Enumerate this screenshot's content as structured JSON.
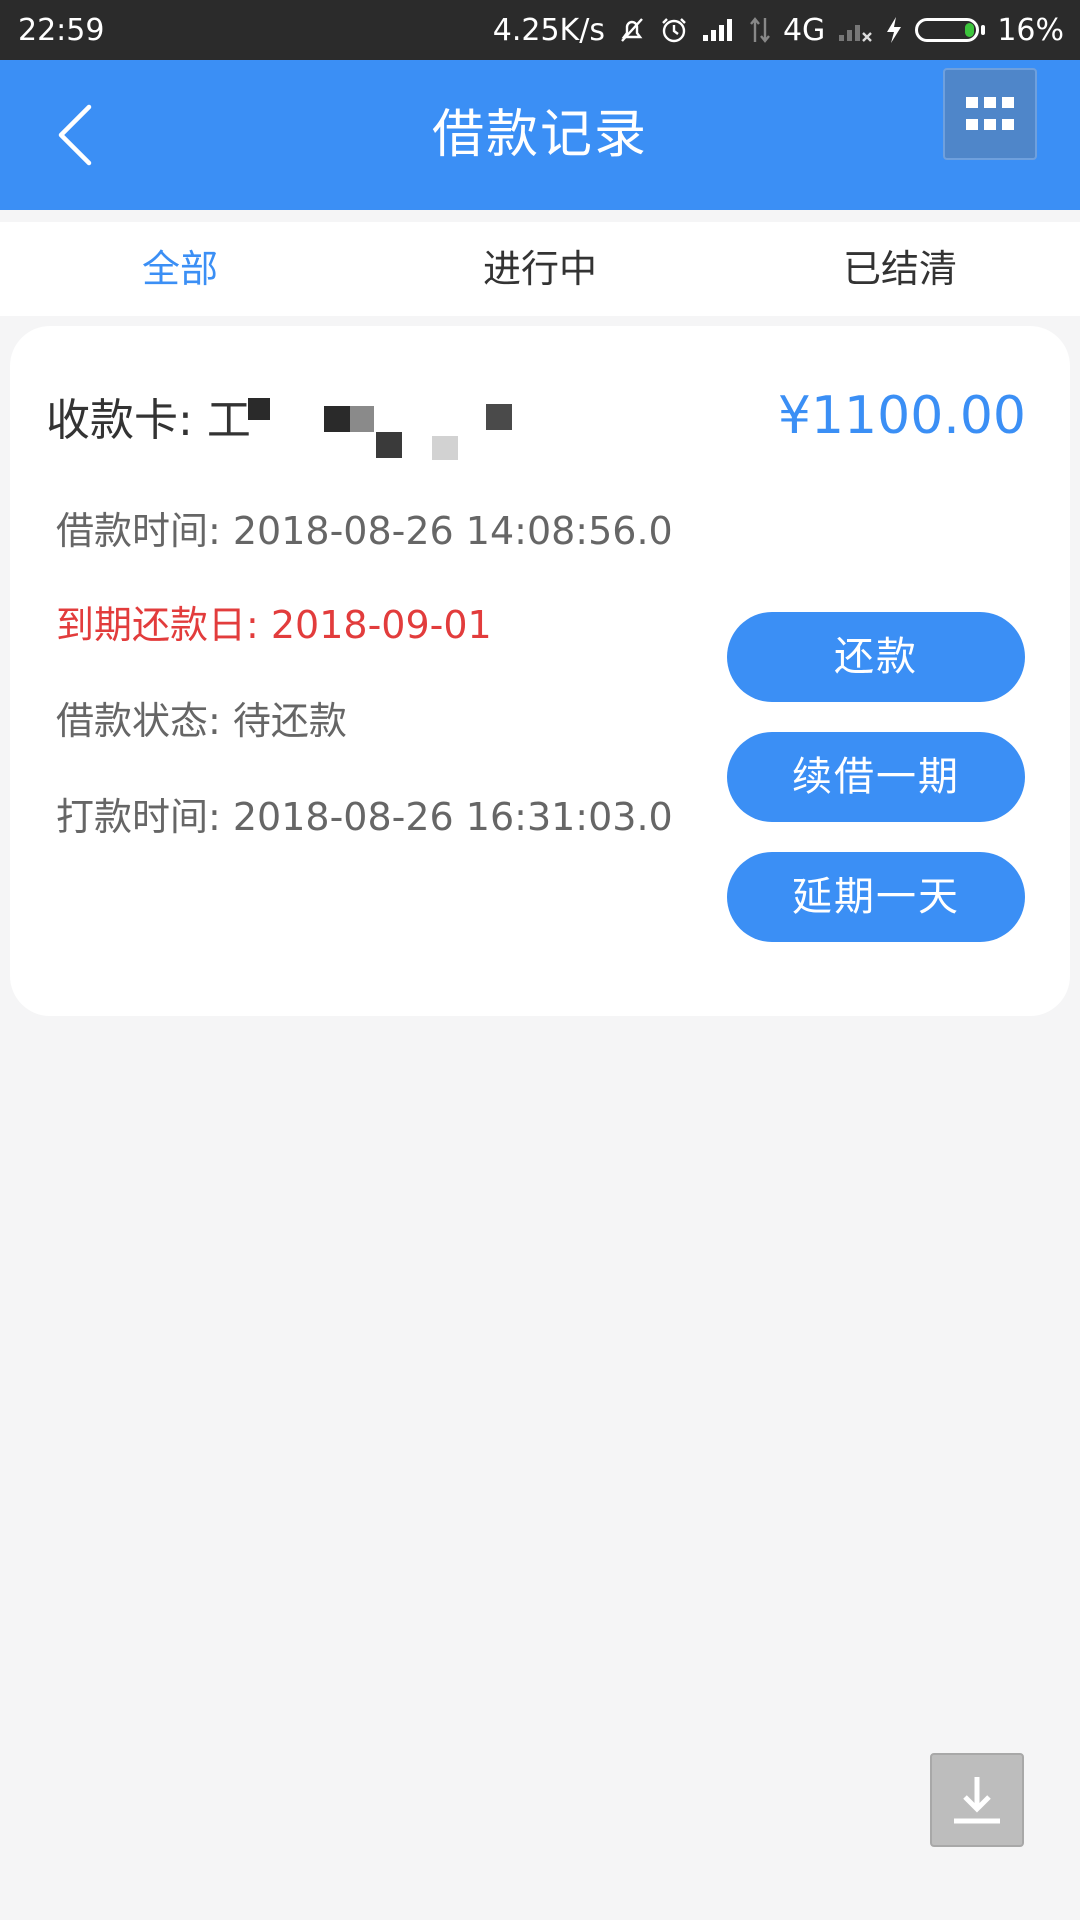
{
  "status_bar": {
    "time": "22:59",
    "network_speed": "4.25K/s",
    "network_type": "4G",
    "battery_percent": "16%",
    "battery_level": 0.16,
    "icons": [
      "mute-bell-icon",
      "alarm-clock-icon",
      "signal-bars-icon",
      "data-arrows-icon",
      "no-signal-icon",
      "charging-bolt-icon",
      "battery-icon"
    ]
  },
  "header": {
    "title": "借款记录",
    "back_icon": "chevron-left-icon",
    "menu_icon": "grid-menu-icon"
  },
  "tabs": [
    {
      "label": "全部",
      "active": true
    },
    {
      "label": "进行中",
      "active": false
    },
    {
      "label": "已结清",
      "active": false
    }
  ],
  "record": {
    "card_label": "收款卡:",
    "card_number_visible": "工",
    "amount": "¥1100.00",
    "loan_time": "借款时间: 2018-08-26 14:08:56.0",
    "due_date": "到期还款日: 2018-09-01",
    "status": "借款状态: 待还款",
    "payment_time": "打款时间: 2018-08-26 16:31:03.0",
    "actions": [
      "还款",
      "续借一期",
      "延期一天"
    ]
  },
  "floating": {
    "download_icon": "download-icon"
  },
  "colors": {
    "primary": "#3b8ff5",
    "due_red": "#e23c3c",
    "background": "#f5f5f6"
  }
}
